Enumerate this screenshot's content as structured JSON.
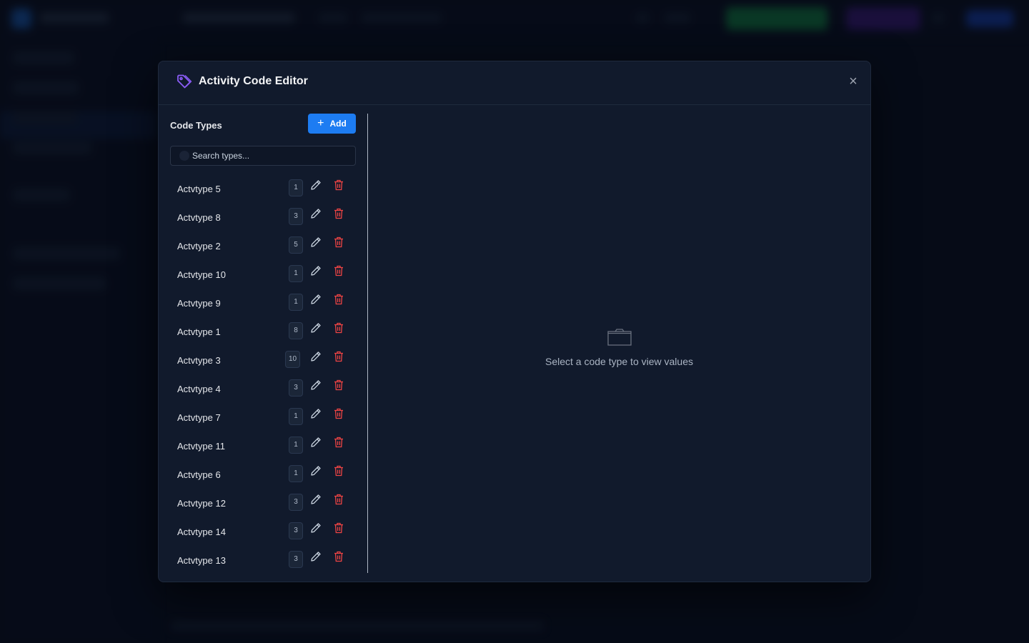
{
  "modal": {
    "title": "Activity Code Editor",
    "close_label": "×",
    "accent_color": "#8b5cf6"
  },
  "left_panel": {
    "title": "Code Types",
    "add_button": {
      "label": "Add",
      "icon": "plus-icon",
      "color": "#1d7cf2"
    },
    "search": {
      "placeholder": "Search types...",
      "value": ""
    },
    "types": [
      {
        "name": "Actvtype 5",
        "count": "1"
      },
      {
        "name": "Actvtype 8",
        "count": "3"
      },
      {
        "name": "Actvtype 2",
        "count": "5"
      },
      {
        "name": "Actvtype 10",
        "count": "1"
      },
      {
        "name": "Actvtype 9",
        "count": "1"
      },
      {
        "name": "Actvtype 1",
        "count": "8"
      },
      {
        "name": "Actvtype 3",
        "count": "10"
      },
      {
        "name": "Actvtype 4",
        "count": "3"
      },
      {
        "name": "Actvtype 7",
        "count": "1"
      },
      {
        "name": "Actvtype 11",
        "count": "1"
      },
      {
        "name": "Actvtype 6",
        "count": "1"
      },
      {
        "name": "Actvtype 12",
        "count": "3"
      },
      {
        "name": "Actvtype 14",
        "count": "3"
      },
      {
        "name": "Actvtype 13",
        "count": "3"
      }
    ],
    "row_icons": {
      "edit": "pencil-icon",
      "delete": "trash-icon",
      "delete_color": "#ef4444"
    }
  },
  "right_panel": {
    "empty_icon": "folder-icon",
    "empty_message": "Select a code type to view values"
  }
}
